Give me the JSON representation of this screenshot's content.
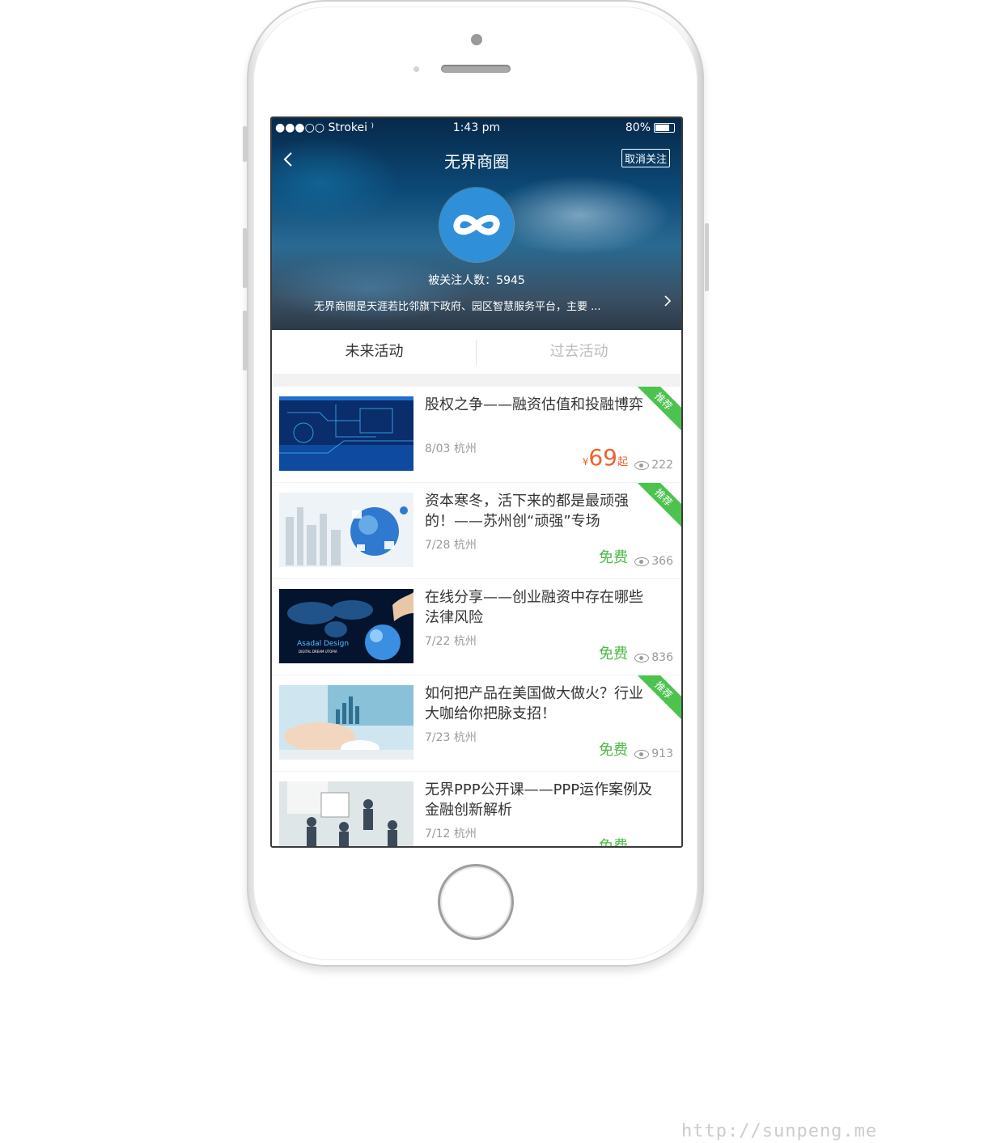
{
  "status_bar": {
    "carrier": "●●●○○ Strokei ⁾",
    "time": "1:43 pm",
    "battery": "80%"
  },
  "nav": {
    "back": "‹",
    "title": "无界商圈",
    "unfollow": "取消关注"
  },
  "profile": {
    "followers": "被关注人数：5945",
    "description": "无界商圈是天涯若比邻旗下政府、园区智慧服务平台，主要 ...",
    "more": "›"
  },
  "tabs": [
    {
      "label": "未来活动",
      "active": true
    },
    {
      "label": "过去活动",
      "active": false
    }
  ],
  "events": [
    {
      "title": "股权之争——融资估值和投融博弈",
      "date": "8/03 杭州",
      "price_currency": "¥",
      "price_amount": "69",
      "price_suffix": "起",
      "price_free": "",
      "views": "222",
      "badge": "推荐"
    },
    {
      "title": "资本寒冬，活下来的都是最顽强的！——苏州创“顽强”专场",
      "date": "7/28 杭州",
      "price_free": "免费",
      "views": "366",
      "badge": "推荐"
    },
    {
      "title": "在线分享——创业融资中存在哪些法律风险",
      "date": "7/22 杭州",
      "price_free": "免费",
      "views": "836",
      "badge": ""
    },
    {
      "title": "如何把产品在美国做大做火？行业大咖给你把脉支招！",
      "date": "7/23 杭州",
      "price_free": "免费",
      "views": "913",
      "badge": "推荐"
    },
    {
      "title": "无界PPP公开课——PPP运作案例及金融创新解析",
      "date": "7/12 杭州",
      "price_free": "免费",
      "views": "",
      "badge": ""
    }
  ],
  "thumb_texts": {
    "asadal": "Asadal Design",
    "asadal_sub": "DIGITAL DREAM UTOPIA"
  },
  "watermark": "http://sunpeng.me",
  "colors": {
    "accent_green": "#4cb848",
    "price_orange": "#f0612d",
    "logo_blue": "#2f8fd8"
  }
}
